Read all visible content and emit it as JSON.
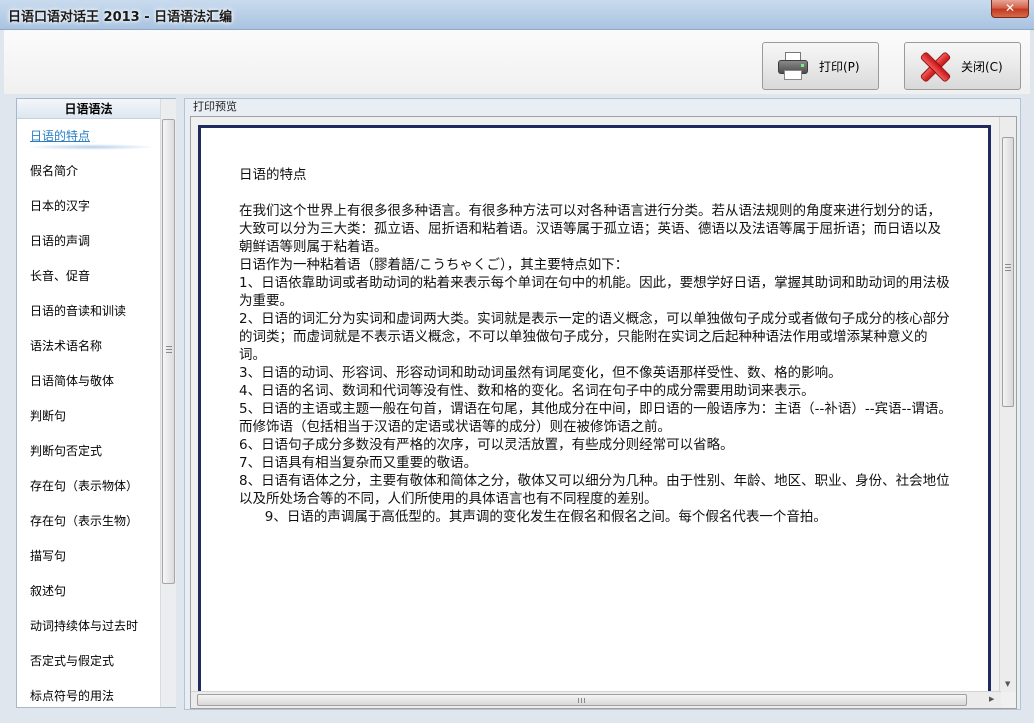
{
  "window": {
    "title": "日语口语对话王 2013 - 日语语法汇编",
    "close_glyph": "✕"
  },
  "toolbar": {
    "print_label": "打印(P)",
    "close_label": "关闭(C)"
  },
  "sidebar": {
    "header": "日语语法",
    "items": [
      {
        "label": "日语的特点",
        "selected": true
      },
      {
        "label": "假名简介"
      },
      {
        "label": "日本的汉字"
      },
      {
        "label": "日语的声调"
      },
      {
        "label": "长音、促音"
      },
      {
        "label": "日语的音读和训读"
      },
      {
        "label": "语法术语名称"
      },
      {
        "label": "日语简体与敬体"
      },
      {
        "label": "判断句"
      },
      {
        "label": "判断句否定式"
      },
      {
        "label": "存在句（表示物体）"
      },
      {
        "label": "存在句（表示生物）"
      },
      {
        "label": "描写句"
      },
      {
        "label": "叙述句"
      },
      {
        "label": "动词持续体与过去时"
      },
      {
        "label": "否定式与假定式"
      },
      {
        "label": "标点符号的用法"
      }
    ]
  },
  "preview": {
    "label": "打印预览",
    "doc_title": "日语的特点",
    "paragraphs": [
      "在我们这个世界上有很多很多种语言。有很多种方法可以对各种语言进行分类。若从语法规则的角度来进行划分的话，大致可以分为三大类：孤立语、屈折语和粘着语。汉语等属于孤立语；英语、德语以及法语等属于屈折语；而日语以及朝鲜语等则属于粘着语。",
      "日语作为一种粘着语（膠着語/こうちゃくご），其主要特点如下：",
      "1、日语依靠助词或者助动词的粘着来表示每个单词在句中的机能。因此，要想学好日语，掌握其助词和助动词的用法极为重要。",
      "2、日语的词汇分为实词和虚词两大类。实词就是表示一定的语义概念，可以单独做句子成分或者做句子成分的核心部分的词类；而虚词就是不表示语义概念，不可以单独做句子成分，只能附在实词之后起种种语法作用或增添某种意义的词。",
      "3、日语的动词、形容词、形容动词和助动词虽然有词尾变化，但不像英语那样受性、数、格的影响。",
      "4、日语的名词、数词和代词等没有性、数和格的变化。名词在句子中的成分需要用助词来表示。",
      "5、日语的主语或主题一般在句首，谓语在句尾，其他成分在中间，即日语的一般语序为：主语（--补语）--宾语--谓语。而修饰语（包括相当于汉语的定语或状语等的成分）则在被修饰语之前。",
      "6、日语句子成分多数没有严格的次序，可以灵活放置，有些成分则经常可以省略。",
      "7、日语具有相当复杂而又重要的敬语。",
      "8、日语有语体之分，主要有敬体和简体之分，敬体又可以细分为几种。由于性别、年龄、地区、职业、身份、社会地位以及所处场合等的不同，人们所使用的具体语言也有不同程度的差别。",
      "      9、日语的声调属于高低型的。其声调的变化发生在假名和假名之间。每个假名代表一个音拍。"
    ]
  },
  "icons": {
    "print": "printer-icon",
    "close": "red-x-icon"
  },
  "colors": {
    "selected_item": "#2a7fc4",
    "paper_border": "#1f2a5e",
    "titlebar": "#b9cfe7"
  }
}
